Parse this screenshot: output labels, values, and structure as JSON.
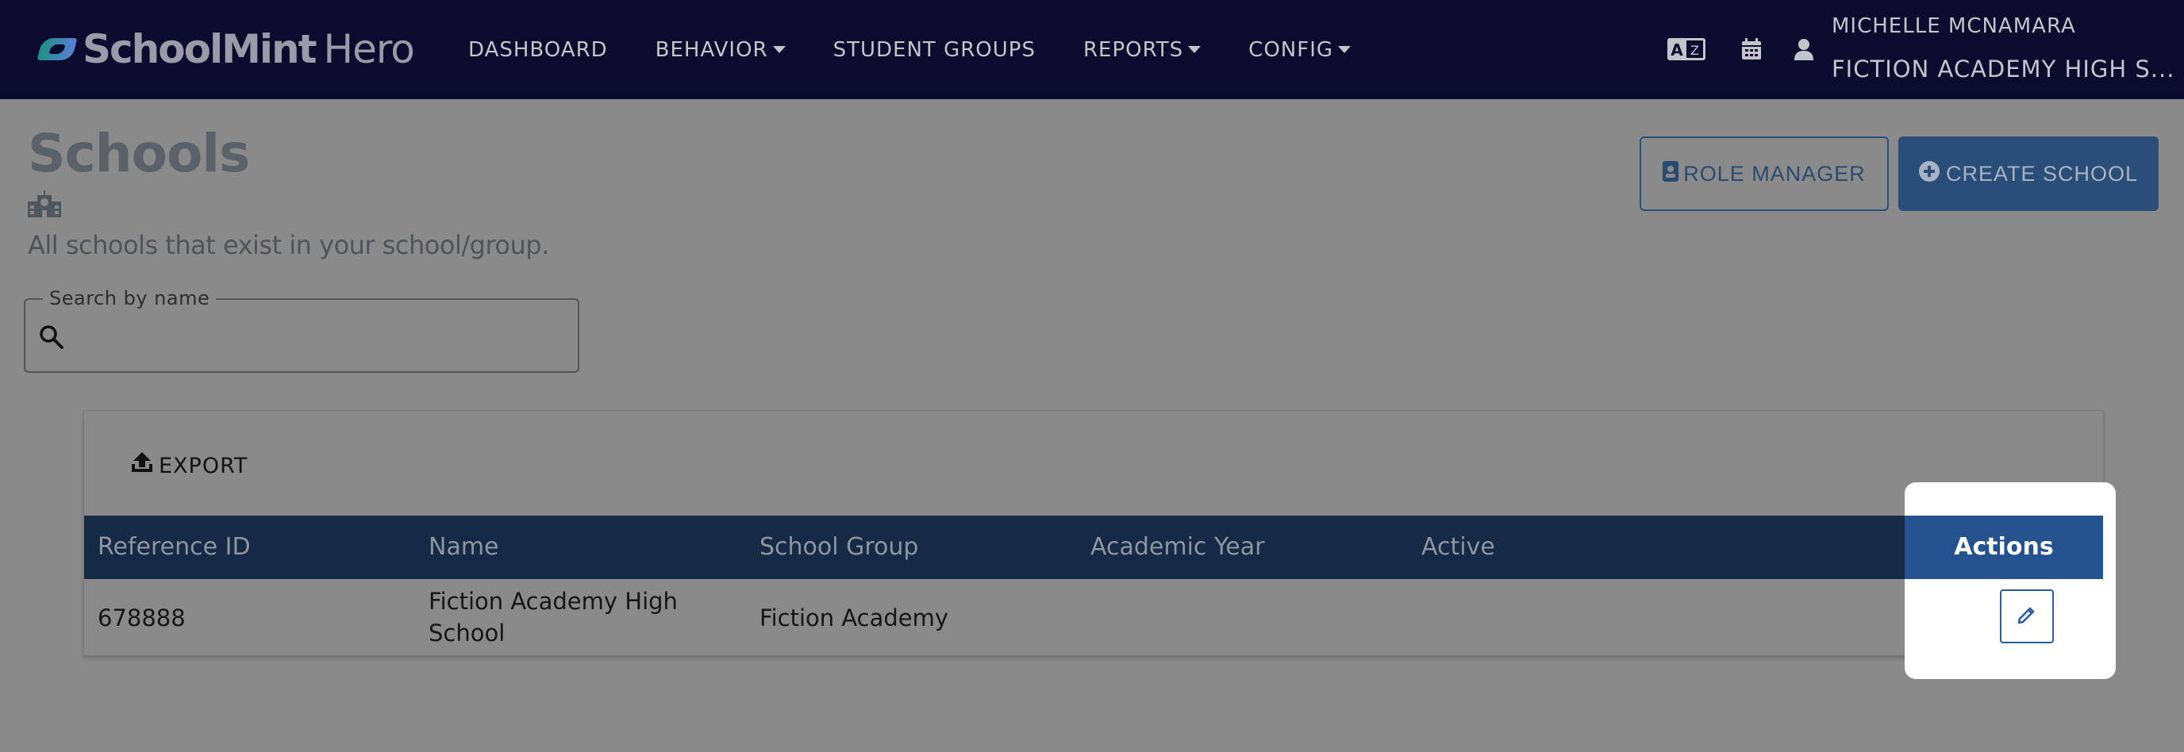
{
  "app": {
    "brand": "SchoolMint",
    "brand_suffix": "Hero"
  },
  "nav": {
    "items": [
      {
        "label": "DASHBOARD",
        "dropdown": false
      },
      {
        "label": "BEHAVIOR",
        "dropdown": true
      },
      {
        "label": "STUDENT GROUPS",
        "dropdown": false
      },
      {
        "label": "REPORTS",
        "dropdown": true
      },
      {
        "label": "CONFIG",
        "dropdown": true
      }
    ]
  },
  "topbar": {
    "icons": [
      "translate-icon",
      "calendar-icon",
      "user-icon"
    ],
    "user_name": "MICHELLE MCNAMARA",
    "user_school": "FICTION ACADEMY HIGH S..."
  },
  "page": {
    "title": "Schools",
    "subtitle": "All schools that exist in your school/group.",
    "role_manager_label": "ROLE MANAGER",
    "create_school_label": "CREATE SCHOOL"
  },
  "search": {
    "label": "Search by name",
    "value": ""
  },
  "table": {
    "export_label": "EXPORT",
    "columns": [
      "Reference ID",
      "Name",
      "School Group",
      "Academic Year",
      "Active",
      "Actions"
    ],
    "rows": [
      {
        "reference_id": "678888",
        "name": "Fiction Academy High School",
        "school_group": "Fiction Academy",
        "academic_year": "",
        "active": ""
      }
    ]
  },
  "colors": {
    "topbar_bg": "#0b0b2e",
    "table_header_bg": "#172a45",
    "actions_header_bg": "#23528e",
    "accent_blue": "#2b5ca0",
    "overlay_bg": "#8a8a8a"
  }
}
